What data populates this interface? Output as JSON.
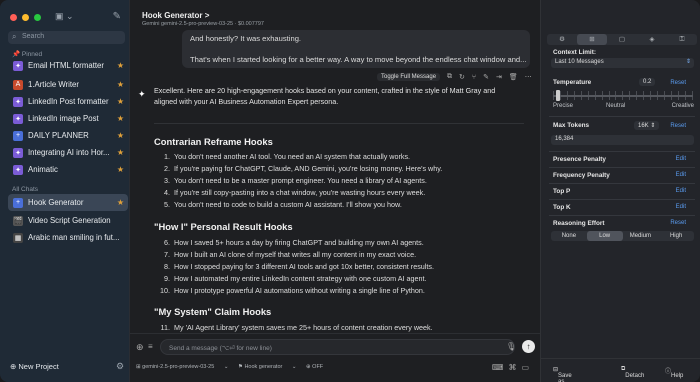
{
  "sidebar": {
    "search_placeholder": "Search",
    "pinned_label": "Pinned",
    "pinned": [
      {
        "label": "Email HTML formatter",
        "icon": "purple-star-icon",
        "color": "#7b5cd6",
        "starred": true
      },
      {
        "label": "1.Article Writer",
        "icon": "a-logo-icon",
        "color": "#c84a2c",
        "starred": true
      },
      {
        "label": "LinkedIn Post formatter",
        "icon": "purple-star-icon",
        "color": "#7b5cd6",
        "starred": true
      },
      {
        "label": "LinkedIn image Post",
        "icon": "purple-star-icon",
        "color": "#7b5cd6",
        "starred": true
      },
      {
        "label": "DAILY PLANNER",
        "icon": "plus-icon",
        "color": "#4a6fd8",
        "starred": true
      },
      {
        "label": "Integrating AI into Hor...",
        "icon": "purple-star-icon",
        "color": "#7b5cd6",
        "starred": true
      },
      {
        "label": "Animatic",
        "icon": "purple-star-icon",
        "color": "#7b5cd6",
        "starred": true
      }
    ],
    "all_chats_label": "All Chats",
    "chats": [
      {
        "label": "Hook Generator",
        "icon": "plus-icon",
        "color": "#4a6fd8",
        "starred": true,
        "selected": true
      },
      {
        "label": "Video Script Generation",
        "icon": "clapper-icon",
        "color": "#555",
        "starred": false
      },
      {
        "label": "Arabic man smiling in fut...",
        "icon": "image-icon",
        "color": "#444",
        "starred": false
      }
    ],
    "new_project": "New Project"
  },
  "header": {
    "title": "Hook Generator",
    "chevron": ">",
    "subtitle": "Gemini gemini-2.5-pro-preview-03-25 · $0.007797"
  },
  "bubble": {
    "line1": "And honestly? It was exhausting.",
    "line2": "That's when I started looking for a better way. A way to move beyond the endless chat window and..."
  },
  "toolbar": {
    "toggle_full": "Toggle Full Message"
  },
  "response": {
    "intro1": "Excellent. Here are 20 high-engagement hooks based on your content, crafted in the style of Matt Gray and",
    "intro2": "aligned with your AI Business Automation Expert persona.",
    "sections": [
      {
        "heading": "Contrarian Reframe Hooks",
        "items": [
          {
            "n": "1.",
            "text": "You don't need another AI tool. You need an AI system that actually works."
          },
          {
            "n": "2.",
            "text": "If you're paying for ChatGPT, Claude, AND Gemini, you're losing money. Here's why."
          },
          {
            "n": "3.",
            "text": "You don't need to be a master prompt engineer. You need a library of AI agents."
          },
          {
            "n": "4.",
            "text": "If you're still copy-pasting into a chat window, you're wasting hours every week."
          },
          {
            "n": "5.",
            "text": "You don't need to code to build a custom AI assistant. I'll show you how."
          }
        ]
      },
      {
        "heading": "\"How I\" Personal Result Hooks",
        "items": [
          {
            "n": "6.",
            "text": "How I saved 5+ hours a day by firing ChatGPT and building my own AI agents."
          },
          {
            "n": "7.",
            "text": "How I built an AI clone of myself that writes all my content in my exact voice."
          },
          {
            "n": "8.",
            "text": "How I stopped paying for 3 different AI tools and got 10x better, consistent results."
          },
          {
            "n": "9.",
            "text": "How I automated my entire LinkedIn content strategy with one custom AI agent."
          },
          {
            "n": "10.",
            "text": "How I prototype powerful AI automations without writing a single line of Python."
          }
        ]
      },
      {
        "heading": "\"My System\" Claim Hooks",
        "items": [
          {
            "n": "11.",
            "text": "My 'AI Agent Library' system saves me 25+ hours of content creation every week."
          }
        ]
      }
    ]
  },
  "composer": {
    "placeholder": "Send a message (⌥⏎ for new line)",
    "model": "gemini-2.5-pro-preview-03-25",
    "assistant": "Hook generator",
    "toggle": "OFF"
  },
  "panel": {
    "tabs": [
      "⚙",
      "⊞",
      "▢",
      "◈",
      "⚿"
    ],
    "active_tab": 1,
    "context_limit_label": "Context Limit:",
    "context_limit_value": "Last 10 Messages",
    "temperature_label": "Temperature",
    "temperature_value": "0.2",
    "reset": "Reset",
    "precise": "Precise",
    "neutral": "Neutral",
    "creative": "Creative",
    "temperature_level": 0.2,
    "max_tokens_label": "Max Tokens",
    "max_tokens_preset": "16K",
    "max_tokens_value": "16,384",
    "presence_penalty": "Presence Penalty",
    "frequency_penalty": "Frequency Penalty",
    "top_p": "Top P",
    "top_k": "Top K",
    "edit": "Edit",
    "reasoning_label": "Reasoning Effort",
    "reasoning_options": [
      "None",
      "Low",
      "Medium",
      "High"
    ],
    "reasoning_selected": "Low",
    "save_default": "Save as Default",
    "detach": "Detach",
    "help": "Help"
  },
  "colors": {
    "accent": "#5a9cf0",
    "star": "#e0a13a",
    "sidebar_bg": "#1f2a36"
  }
}
